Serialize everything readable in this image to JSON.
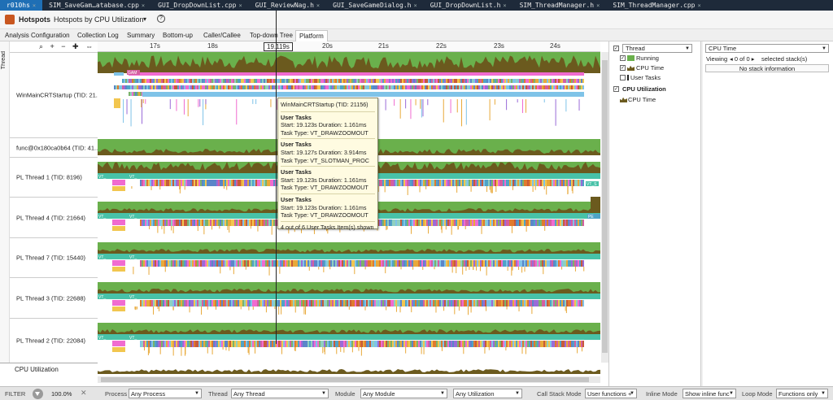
{
  "editor_tabs": [
    {
      "label": "r010hs",
      "active": true
    },
    {
      "label": "SIM_SaveGam…atabase.cpp",
      "active": false
    },
    {
      "label": "GUI_DropDownList.cpp",
      "active": false
    },
    {
      "label": "GUI_ReviewNag.h",
      "active": false
    },
    {
      "label": "GUI_SaveGameDialog.h",
      "active": false
    },
    {
      "label": "GUI_DropDownList.h",
      "active": false
    },
    {
      "label": "SIM_ThreadManager.h",
      "active": false
    },
    {
      "label": "SIM_ThreadManager.cpp",
      "active": false
    }
  ],
  "header": {
    "title": "Hotspots",
    "analysis": "Hotspots by CPU Utilization",
    "help": "?"
  },
  "view_tabs": [
    "Analysis Configuration",
    "Collection Log",
    "Summary",
    "Bottom-up",
    "Caller/Callee",
    "Top-down Tree",
    "Platform"
  ],
  "active_view_tab": "Platform",
  "timeline": {
    "axis_label": "Thread",
    "zoom_tools": "⌕ + − ✚ ⇔",
    "cursor_time": "19.119s",
    "ticks": [
      "17s",
      "18s",
      "19s",
      "20s",
      "21s",
      "22s",
      "23s",
      "24s"
    ],
    "threads": [
      "WinMainCRTStartup (TID: 21...",
      "func@0x180ca0b64 (TID: 41...",
      "PL Thread 1 (TID: 8196)",
      "PL Thread 4 (TID: 21664)",
      "PL Thread 7 (TID: 15440)",
      "PL Thread 3 (TID: 22688)",
      "PL Thread 2 (TID: 22084)"
    ],
    "cpu_row_label": "CPU Utilization",
    "task_tags": {
      "vt": "VT_",
      "gam": "GAM",
      "vts": "VT_S",
      "pe": "PE"
    }
  },
  "tooltip": {
    "title": "WinMainCRTStartup (TID: 21156)",
    "blocks": [
      {
        "type": "User Tasks",
        "timing": "Start: 19.123s Duration: 1.161ms",
        "task": "Task Type: VT_DRAWZOOMOUT"
      },
      {
        "type": "User Tasks",
        "timing": "Start: 19.127s Duration: 3.914ms",
        "task": "Task Type: VT_SLOTMAN_PROC"
      },
      {
        "type": "User Tasks",
        "timing": "Start: 19.123s Duration: 1.161ms",
        "task": "Task Type: VT_DRAWZOOMOUT"
      },
      {
        "type": "User Tasks",
        "timing": "Start: 19.123s Duration: 1.161ms",
        "task": "Task Type: VT_DRAWZOOMOUT"
      }
    ],
    "footer": "4 out of 6 User Tasks Item(s) shown"
  },
  "legend": {
    "group_select": "Thread",
    "items": [
      {
        "label": "Running",
        "checked": true
      },
      {
        "label": "CPU Time",
        "checked": true
      },
      {
        "label": "User Tasks",
        "checked": false
      }
    ],
    "cpu_section": "CPU Utilization",
    "cpu_item": "CPU Time"
  },
  "stack_panel": {
    "metric_select": "CPU Time",
    "viewing_label": "Viewing",
    "nav": "◂ 0 of 0 ▸",
    "selected_text": "selected stack(s)",
    "empty": "No stack information"
  },
  "filter_bar": {
    "label": "FILTER",
    "percent": "100.0%",
    "process_label": "Process",
    "process_value": "Any Process",
    "thread_label": "Thread",
    "thread_value": "Any Thread",
    "module_label": "Module",
    "module_value": "Any Module",
    "utilization_value": "Any Utilization",
    "callstack_label": "Call Stack Mode",
    "callstack_value": "User functions +",
    "inline_label": "Inline Mode",
    "inline_value": "Show inline func",
    "loop_label": "Loop Mode",
    "loop_value": "Functions only"
  },
  "colors": {
    "running": "#6ab04c",
    "cpu_time": "#6b5a1e",
    "tooltip_bg": "#fffbe1",
    "active_editor_tab": "#1f6fb5",
    "editor_tab_bg": "#1e2a3a"
  }
}
